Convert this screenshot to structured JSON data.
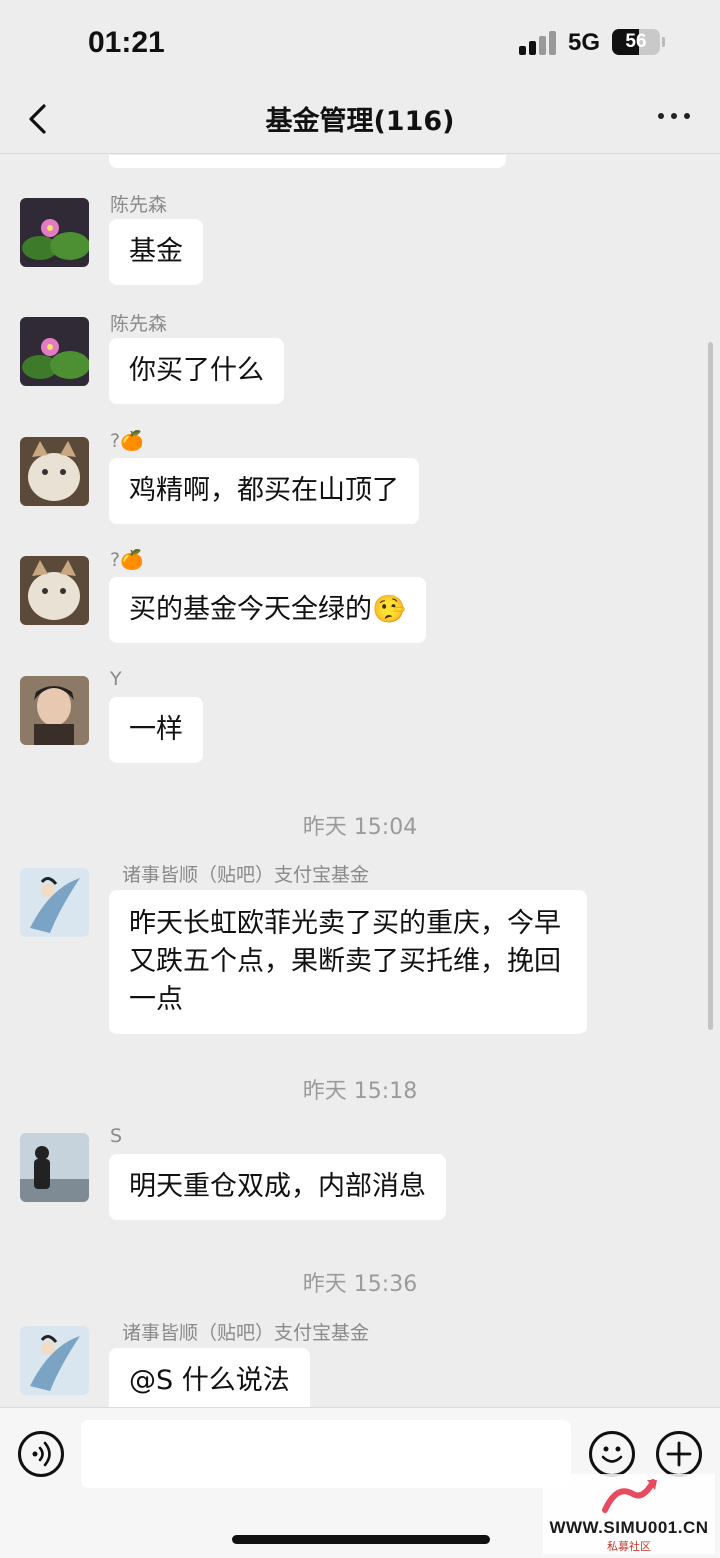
{
  "status_bar": {
    "time": "01:21",
    "network": "5G",
    "battery": "56",
    "battery_level": 0.56
  },
  "header": {
    "title": "基金管理(116)"
  },
  "messages": [
    {
      "sender": "陈先森",
      "text": "基金"
    },
    {
      "sender": "陈先森",
      "text": "你买了什么"
    },
    {
      "sender": "?🍊",
      "text": "鸡精啊，都买在山顶了"
    },
    {
      "sender": "?🍊",
      "text": "买的基金今天全绿的🤥"
    },
    {
      "sender": "Y",
      "text": "一样"
    },
    {
      "timestamp": "昨天 15:04"
    },
    {
      "sender": "诸事皆顺（贴吧）支付宝基金",
      "text": "昨天长虹欧菲光卖了买的重庆，今早又跌五个点，果断卖了买托维，挽回一点"
    },
    {
      "timestamp": "昨天 15:18"
    },
    {
      "sender": "S",
      "text": "明天重仓双成，内部消息"
    },
    {
      "timestamp": "昨天 15:36"
    },
    {
      "sender": "诸事皆顺（贴吧）支付宝基金",
      "text": "@S 什么说法"
    }
  ],
  "watermark": {
    "site": "WWW.SIMU001.CN",
    "name": "私募社区"
  },
  "icons": [
    "back-arrow-icon",
    "more-dots-icon",
    "voice-icon",
    "emoji-icon",
    "plus-icon"
  ]
}
